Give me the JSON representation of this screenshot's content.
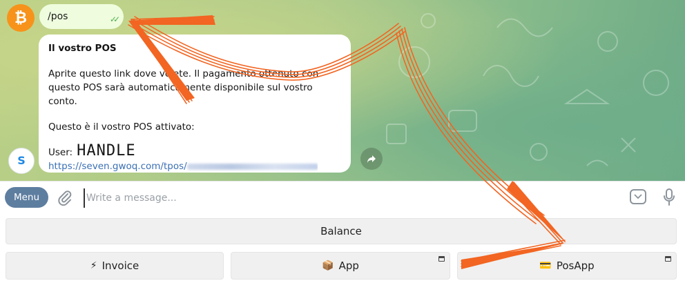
{
  "chat": {
    "bitcoin_avatar_glyph": "₿",
    "outgoing_message": {
      "text": "/pos",
      "status_icon": "double-check-icon"
    },
    "incoming_message": {
      "title": "Il vostro POS",
      "body_line1": "Aprite questo link dove volete. Il pagamento ottenuto con",
      "body_line2": "questo POS sarà automaticamente disponibile sul vostro conto.",
      "activated_line": "Questo è il vostro POS attivato:",
      "user_label": "User:",
      "user_handle": "HANDLE",
      "link_prefix": "https://seven.gwoq.com/tpos/"
    },
    "share_icon": "share-icon"
  },
  "input_bar": {
    "menu_label": "Menu",
    "placeholder": "Write a message...",
    "attach_icon": "paperclip-icon",
    "keyboard_toggle_icon": "keyboard-toggle-icon",
    "mic_icon": "microphone-icon"
  },
  "keyboard": {
    "balance_label": "Balance",
    "invoice": {
      "emoji": "⚡",
      "label": "Invoice"
    },
    "app": {
      "emoji": "📦",
      "label": "App"
    },
    "posapp": {
      "emoji": "💳",
      "label": "PosApp"
    }
  },
  "colors": {
    "accent_arrow": "#f26522",
    "menu_button": "#5e7ea0",
    "bitcoin_orange": "#f7931a",
    "outgoing_bubble": "#effdde"
  }
}
